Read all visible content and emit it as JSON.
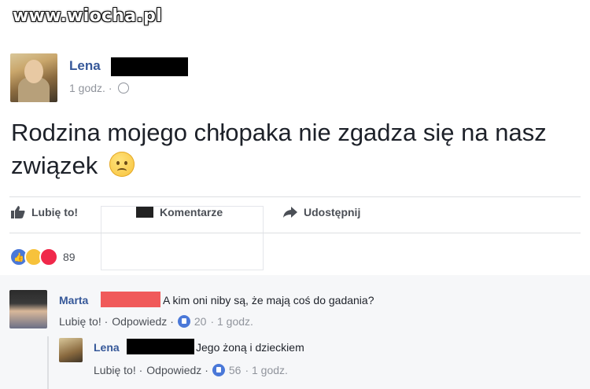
{
  "watermark": "www.wiocha.pl",
  "post": {
    "author": "Lena",
    "time": "1 godz. ·",
    "text": "Rodzina mojego chłopaka nie zgadza się na nasz związek",
    "emoji_icon": "sad-face-icon"
  },
  "actions": {
    "like": "Lubię to!",
    "comment": "Komentarze",
    "share": "Udostępnij"
  },
  "reactions": {
    "count": "89",
    "types": [
      "like",
      "haha",
      "love"
    ]
  },
  "comments": [
    {
      "author": "Marta",
      "text": "A kim oni niby są, że mają coś do gadania?",
      "like_label": "Lubię to! ·",
      "reply_label": "Odpowiedz ·",
      "likes": "20",
      "time": "· 1 godz."
    },
    {
      "author": "Lena",
      "text": "Jego żoną i dzieckiem",
      "like_label": "Lubię to! ·",
      "reply_label": "Odpowiedz ·",
      "likes": "56",
      "time": "· 1 godz."
    }
  ],
  "colors": {
    "link_blue": "#365899",
    "muted": "#90949c",
    "redaction_black": "#000000",
    "redaction_red": "#f05a5a"
  }
}
